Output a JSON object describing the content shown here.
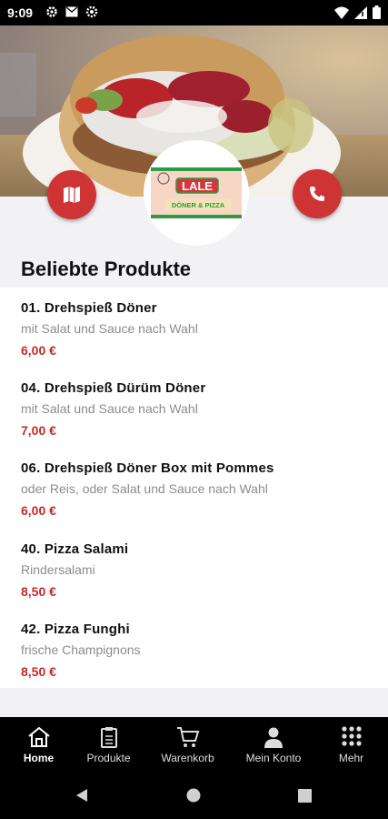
{
  "status": {
    "time": "9:09"
  },
  "hero": {
    "logo_name": "LALE",
    "logo_sub": "DÖNER & PIZZA"
  },
  "section_title": "Beliebte Produkte",
  "products": [
    {
      "name": "01. Drehspieß Döner",
      "desc": "mit Salat und Sauce nach Wahl",
      "price": "6,00 €"
    },
    {
      "name": "04. Drehspieß Dürüm Döner",
      "desc": "mit Salat und Sauce nach Wahl",
      "price": "7,00 €"
    },
    {
      "name": "06. Drehspieß Döner Box mit Pommes",
      "desc": "oder Reis, oder Salat und Sauce nach Wahl",
      "price": "6,00 €"
    },
    {
      "name": "40. Pizza Salami",
      "desc": "Rindersalami",
      "price": "8,50 €"
    },
    {
      "name": "42. Pizza Funghi",
      "desc": "frische Champignons",
      "price": "8,50 €"
    }
  ],
  "nav": {
    "home": "Home",
    "products": "Produkte",
    "cart": "Warenkorb",
    "account": "Mein Konto",
    "more": "Mehr"
  },
  "colors": {
    "accent": "#cf3434",
    "price": "#c42a2a"
  }
}
